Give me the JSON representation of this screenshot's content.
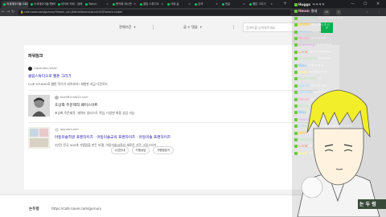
{
  "browser": {
    "tabs": [
      {
        "label": "이세계아이돌 스트리머 팬카페 : 네이버 카페",
        "active": true
      },
      {
        "label": "이세계아이돌 팬카페 - 네이버 카페",
        "active": false
      },
      {
        "label": "네이버 카페 : 검색",
        "active": false
      },
      {
        "label": "Twitch",
        "active": false
      },
      {
        "label": "팬카페 게시판",
        "active": false
      },
      {
        "label": "클립 스튜디오",
        "active": false
      },
      {
        "label": "카페 글",
        "active": false
      },
      {
        "label": "검색",
        "active": false
      },
      {
        "label": "댓글",
        "active": false
      },
      {
        "label": "웹툰 그리기",
        "active": false
      }
    ],
    "new_tab": "+",
    "controls": {
      "minimize": "—",
      "maximize": "☐",
      "close": "✕"
    },
    "nav": {
      "back": "←",
      "forward": "→",
      "reload": "↻"
    },
    "address": "cafe.naver.com/gurnury?iframe_url=/ArticleSearchList.nhn%3Fsearch.clubid",
    "extensions": [
      {
        "label": "15",
        "badge": true
      },
      {
        "label": "1",
        "badge": true
      },
      {
        "label": "☆",
        "badge": false
      },
      {
        "label": "⋮",
        "badge": false
      }
    ]
  },
  "filters": {
    "period": "전체기간",
    "scope": "글 + 댓글",
    "search_placeholder": "검색어를 입력해주세요",
    "search_icon": "search-icon",
    "accent": "#03c75a"
  },
  "links_section": {
    "title": "파워링크",
    "items": [
      {
        "source": "clipstudio.net/kr",
        "title": "클립스튜디오로 웹툰 그리기",
        "desc": "CLIP STUDIO로 웹툰 작가가 되어보자! 체험판 지금 다운로드"
      },
      {
        "source": "boe062cafe20.com",
        "title": "초상화 주문제작 페이스아트",
        "desc": "초상화 주문제작, 캐릭터 일러스트 작업, 다양한 화풍 상담 가능"
      },
      {
        "source": "ogyuart.com",
        "title": "아동미술학원 프랜차이즈 · 아동미술교육 프랜차이즈 · 아동미술 프랜차이즈",
        "desc": "3년간 전국 500개 가맹점을 만든 비결, 아동미술교육의 새로운 기준 그림그리기"
      }
    ],
    "pills": [
      "수업안내",
      "가맹상담",
      "가맹점찾기"
    ]
  },
  "footer": {
    "label": "논두렁",
    "separator": ":",
    "url": "https://cafe.naver.com/gurnury"
  },
  "chat": {
    "lines": [
      {
        "user": "Huggs",
        "text": "ㅋㅋㅋㅋ",
        "color": "#e4e4e4"
      },
      {
        "user": "Hman",
        "text": "왔네",
        "color": "#ffb0d0"
      },
      {
        "user": "Keyboard",
        "text": "ㅋㅋㅋㅋㅋㅋㅋㅋ",
        "color": "#c8e6c9"
      },
      {
        "user": "JMMM",
        "text": "ㅎㅇㅎㅇㅎㅇ",
        "color": "#ffd54f"
      },
      {
        "user": "Johnie",
        "text": "ㅋㅋ",
        "color": "#bbdefb"
      },
      {
        "user": "Hman",
        "text": "ㅋㅋㅋㅋㅋ",
        "color": "#ffb0d0"
      },
      {
        "user": "dooooog",
        "text": "ㅋㅋㅋㅋㅋ",
        "color": "#e1bee7"
      },
      {
        "user": "ㄴㅇㄹ",
        "text": "ㅋㅋㅋㅋㅋㅋㅋ",
        "color": "#ff8a65"
      },
      {
        "user": "Keyboard",
        "text": "ㅋㅋㅋㅋ",
        "color": "#c8e6c9"
      },
      {
        "user": "Wax",
        "text": "ㅋㅋㅋㅋㅋ",
        "color": "#90caf9"
      },
      {
        "user": "fanA",
        "text": "ㅋㅋㅋㅋㅋㅋ",
        "color": "#fff59d"
      },
      {
        "user": "Keyboard",
        "text": "ㅋ",
        "color": "#c8e6c9"
      },
      {
        "user": "JohnK",
        "text": "ㅋㅋㅋㅋㅋ",
        "color": "#bbdefb"
      },
      {
        "user": "JohnieK",
        "text": "ㄹㅇㅋㅋ",
        "color": "#bbdefb"
      },
      {
        "user": "Hman",
        "text": "ㅋㅋㅋㅋㅋ",
        "color": "#ffb0d0"
      },
      {
        "user": "Keyboard",
        "text": "ㅋㅋㅋ",
        "color": "#c8e6c9"
      },
      {
        "user": "Wax",
        "text": "ㅋㅋㅋㅋ",
        "color": "#90caf9"
      },
      {
        "user": "dooooog",
        "text": "ㅋㅋㅋㅋ",
        "color": "#e1bee7"
      },
      {
        "user": "Johnie",
        "text": "ㅋㅋㅋㅋㅋㅋㅋㅋㅋㅋㅋㅋㅋ",
        "color": "#bbdefb"
      },
      {
        "user": "JMM",
        "text": "ㅋㅋㅋㅋㅋㅋㅋㅋ",
        "color": "#ffd54f"
      },
      {
        "user": "Keyboard",
        "text": "ㅋㅋㅋㅋㅋㅋ",
        "color": "#c8e6c9"
      },
      {
        "user": "ㄴㅇㄹ",
        "text": "ㅋㅋㅋ",
        "color": "#ff8a65"
      },
      {
        "user": "fanB",
        "text": "ㅋㅋㅋ",
        "color": "#fff59d"
      }
    ]
  },
  "avatar": {
    "name_tag": "논 두 렁",
    "hair_color": "#f2ee2a",
    "badge_color": "#3a4a3a"
  }
}
